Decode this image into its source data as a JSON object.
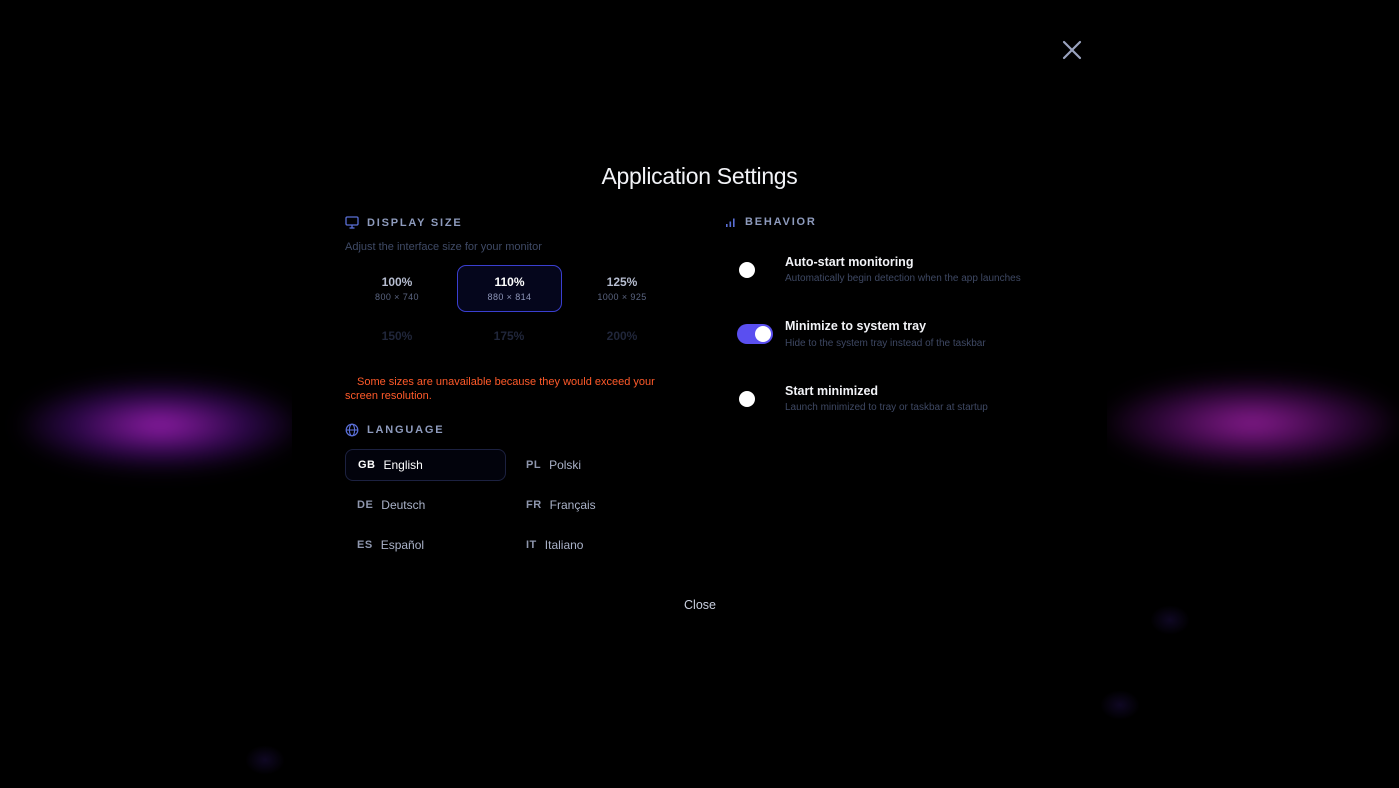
{
  "dialog": {
    "title": "Application Settings",
    "close_label": "Close"
  },
  "display_size": {
    "heading": "DISPLAY SIZE",
    "description": "Adjust the interface size for your monitor",
    "options": [
      {
        "percent": "100%",
        "resolution": "800 × 740",
        "state": "available"
      },
      {
        "percent": "110%",
        "resolution": "880 × 814",
        "state": "selected"
      },
      {
        "percent": "125%",
        "resolution": "1000 × 925",
        "state": "available"
      },
      {
        "percent": "150%",
        "resolution": "",
        "state": "disabled"
      },
      {
        "percent": "175%",
        "resolution": "",
        "state": "disabled"
      },
      {
        "percent": "200%",
        "resolution": "",
        "state": "disabled"
      }
    ],
    "warning": "Some sizes are unavailable because they would exceed your screen resolution."
  },
  "language": {
    "heading": "LANGUAGE",
    "options": [
      {
        "code": "GB",
        "name": "English",
        "selected": true
      },
      {
        "code": "PL",
        "name": "Polski",
        "selected": false
      },
      {
        "code": "DE",
        "name": "Deutsch",
        "selected": false
      },
      {
        "code": "FR",
        "name": "Français",
        "selected": false
      },
      {
        "code": "ES",
        "name": "Español",
        "selected": false
      },
      {
        "code": "IT",
        "name": "Italiano",
        "selected": false
      }
    ]
  },
  "behavior": {
    "heading": "BEHAVIOR",
    "items": [
      {
        "title": "Auto-start monitoring",
        "description": "Automatically begin detection when the app launches",
        "enabled": false
      },
      {
        "title": "Minimize to system tray",
        "description": "Hide to the system tray instead of the taskbar",
        "enabled": true
      },
      {
        "title": "Start minimized",
        "description": "Launch minimized to tray or taskbar at startup",
        "enabled": false
      }
    ]
  },
  "colors": {
    "accent": "#5a4ff0",
    "selected_border": "#3a3fd0",
    "warning": "#ff5a2a",
    "background": "#000000"
  },
  "icons": {
    "close": "close-icon",
    "display": "monitor-icon",
    "language": "globe-icon",
    "behavior": "signal-bars-icon"
  }
}
